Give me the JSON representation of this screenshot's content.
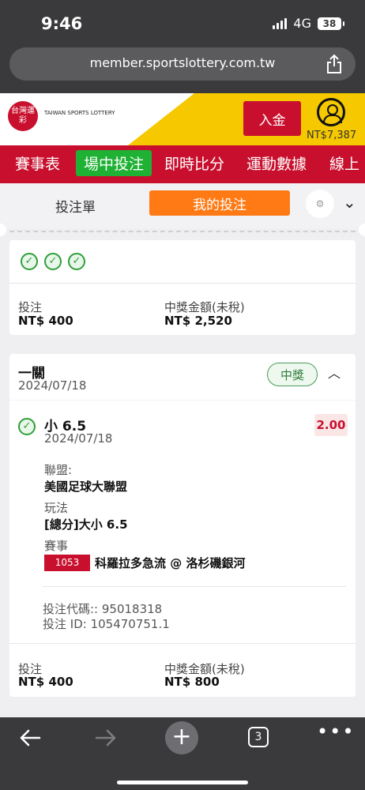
{
  "status": {
    "time": "9:46",
    "network": "4G",
    "battery": "38"
  },
  "browser": {
    "url": "member.sportslottery.com.tw"
  },
  "header": {
    "logo_text": "台灣運彩",
    "logo_sub": "TAIWAN SPORTS LOTTERY",
    "deposit_label": "入金",
    "balance": "NT$7,387"
  },
  "nav": {
    "items": [
      "賽事表",
      "場中投注",
      "即時比分",
      "運動數據",
      "線上"
    ],
    "active_index": 1
  },
  "tabs": {
    "slip": "投注單",
    "my_bets": "我的投注"
  },
  "card1": {
    "stake_label": "投注",
    "stake_value": "NT$ 400",
    "payout_label": "中獎金額(未稅)",
    "payout_value": "NT$ 2,520"
  },
  "card2": {
    "bet_type": "一關",
    "bet_date": "2024/07/18",
    "status_badge": "中獎",
    "selection": "小 6.5",
    "selection_date": "2024/07/18",
    "odds": "2.00",
    "league_label": "聯盟:",
    "league": "美國足球大聯盟",
    "market_label": "玩法",
    "market": "[總分]大小 6.5",
    "event_label": "賽事",
    "match_no": "1053",
    "match": "科羅拉多急流 @ 洛杉磯銀河",
    "code_line": "投注代碼:: 95018318",
    "id_line": "投注 ID: 105470751.1",
    "stake_label": "投注",
    "stake_value": "NT$ 400",
    "payout_label": "中獎金額(未稅)",
    "payout_value": "NT$ 800"
  },
  "toolbar": {
    "tab_count": "3"
  },
  "colors": {
    "brand_red": "#c8102e",
    "active_green": "#1eb133",
    "orange": "#ff7a14",
    "yellow": "#f5c800"
  }
}
